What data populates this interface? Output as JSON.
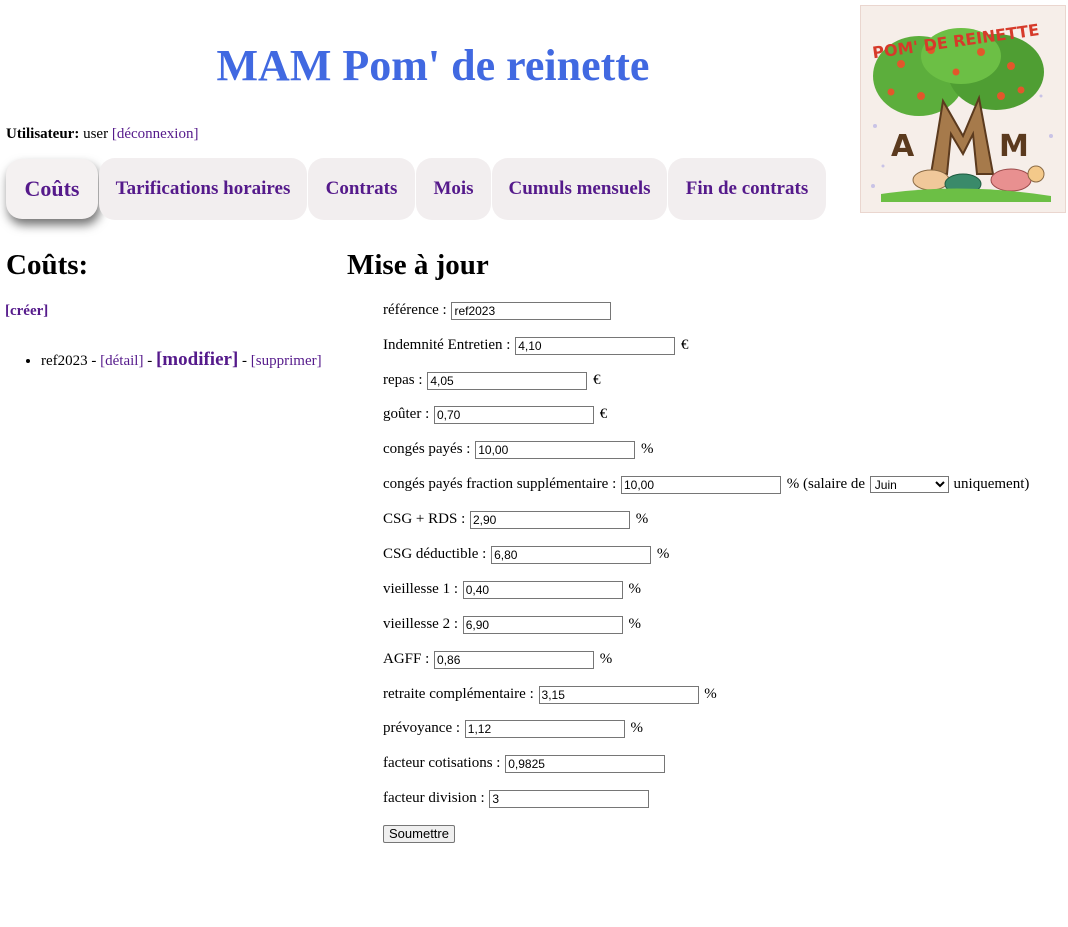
{
  "header": {
    "title": "MAM Pom' de reinette",
    "logo_text": "POM' DE REINETTE",
    "logo_letters": "MAM"
  },
  "userbar": {
    "user_label": "Utilisateur:",
    "user_name": "user",
    "logout": "[déconnexion]"
  },
  "nav": {
    "tabs": [
      "Coûts",
      "Tarifications horaires",
      "Contrats",
      "Mois",
      "Cumuls mensuels",
      "Fin de contrats"
    ],
    "active": "Coûts"
  },
  "left": {
    "title": "Coûts:",
    "create": "[créer]",
    "items": [
      {
        "name": "ref2023",
        "sep": "-",
        "detail": "[détail]",
        "modify": "[modifier]",
        "delete": "[supprimer]"
      }
    ]
  },
  "form": {
    "title": "Mise à jour",
    "fields": {
      "reference": {
        "label": "référence :",
        "value": "ref2023"
      },
      "indemnite": {
        "label": "Indemnité Entretien :",
        "value": "4,10",
        "unit": "€"
      },
      "repas": {
        "label": "repas :",
        "value": "4,05",
        "unit": "€"
      },
      "gouter": {
        "label": "goûter :",
        "value": "0,70",
        "unit": "€"
      },
      "conges": {
        "label": "congés payés :",
        "value": "10,00",
        "unit": "%"
      },
      "conges_frac": {
        "label": "congés payés fraction supplémentaire :",
        "value": "10,00",
        "unit": "% (salaire de",
        "month": "Juin",
        "suffix": "uniquement)"
      },
      "csg_rds": {
        "label": "CSG + RDS :",
        "value": "2,90",
        "unit": "%"
      },
      "csg_ded": {
        "label": "CSG déductible :",
        "value": "6,80",
        "unit": "%"
      },
      "vieillesse1": {
        "label": "vieillesse 1 :",
        "value": "0,40",
        "unit": "%"
      },
      "vieillesse2": {
        "label": "vieillesse 2 :",
        "value": "6,90",
        "unit": "%"
      },
      "agff": {
        "label": "AGFF :",
        "value": "0,86",
        "unit": "%"
      },
      "retraite": {
        "label": "retraite complémentaire :",
        "value": "3,15",
        "unit": "%"
      },
      "prevoyance": {
        "label": "prévoyance :",
        "value": "1,12",
        "unit": "%"
      },
      "facteur_cot": {
        "label": "facteur cotisations :",
        "value": "0,9825"
      },
      "facteur_div": {
        "label": "facteur division :",
        "value": "3"
      }
    },
    "submit": "Soumettre"
  },
  "colors": {
    "title": "#4169e1",
    "link": "#551a8b",
    "tab_bg": "#f2eeef"
  }
}
